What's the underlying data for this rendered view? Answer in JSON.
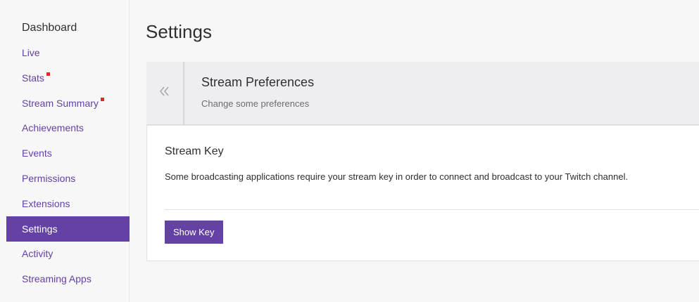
{
  "sidebar": {
    "title": "Dashboard",
    "items": [
      {
        "label": "Live",
        "dot": false
      },
      {
        "label": "Stats",
        "dot": true
      },
      {
        "label": "Stream Summary",
        "dot": true
      },
      {
        "label": "Achievements",
        "dot": false
      },
      {
        "label": "Events",
        "dot": false
      },
      {
        "label": "Permissions",
        "dot": false
      },
      {
        "label": "Extensions",
        "dot": false
      },
      {
        "label": "Settings",
        "dot": false,
        "active": true
      },
      {
        "label": "Activity",
        "dot": false
      },
      {
        "label": "Streaming Apps",
        "dot": false
      }
    ]
  },
  "main": {
    "title": "Settings",
    "preferences": {
      "back_icon": "double-chevron-left-icon",
      "title": "Stream Preferences",
      "subtitle": "Change some preferences"
    },
    "stream_key": {
      "title": "Stream Key",
      "description": "Some broadcasting applications require your stream key in order to connect and broadcast to your Twitch channel.",
      "button_label": "Show Key"
    }
  },
  "colors": {
    "accent": "#6441a4",
    "notification_dot": "#e02828"
  }
}
